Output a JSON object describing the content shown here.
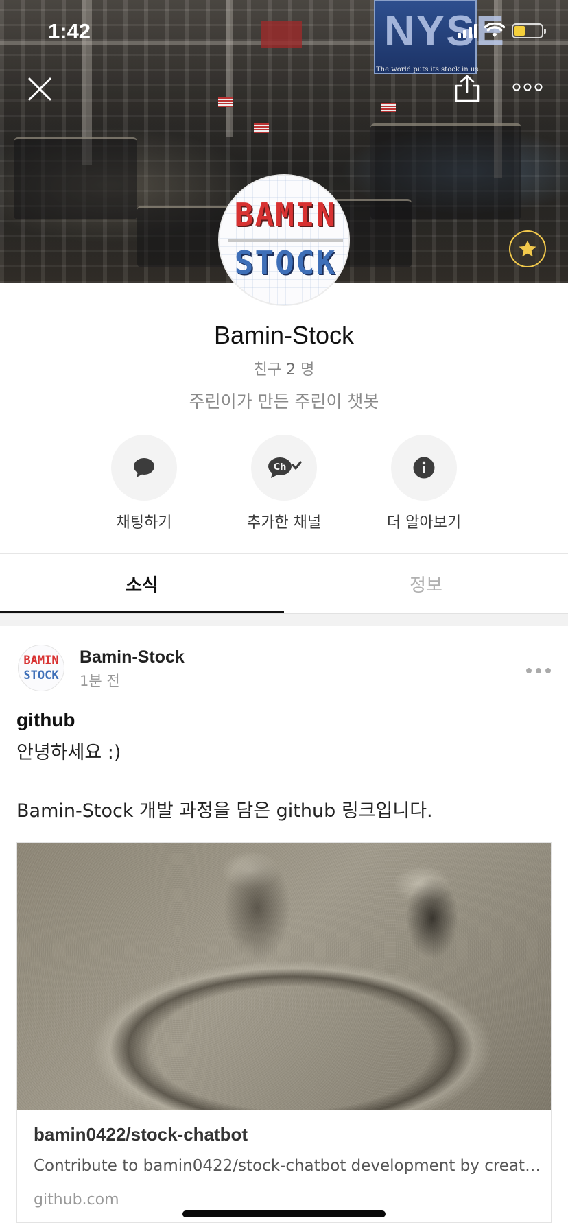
{
  "status_bar": {
    "time": "1:42",
    "battery_level": 0.4
  },
  "cover": {
    "image": "nyse-trading-floor-photo",
    "sign_text": "NYSE",
    "sign_caption": "The world puts its stock in us"
  },
  "header": {
    "close_icon": "close-icon",
    "share_icon": "share-icon",
    "more_icon": "more-icon"
  },
  "profile": {
    "logo_top": "BAMIN",
    "logo_bottom": "STOCK",
    "name": "Bamin-Stock",
    "friends_label": "친구",
    "friends_count": "2",
    "friends_unit": "명",
    "description": "주린이가 만든 주린이 챗봇"
  },
  "actions": [
    {
      "label": "채팅하기",
      "icon": "chat-bubble-icon"
    },
    {
      "label": "추가한 채널",
      "icon": "channel-added-icon"
    },
    {
      "label": "더 알아보기",
      "icon": "info-icon"
    }
  ],
  "tabs": [
    {
      "label": "소식",
      "active": true
    },
    {
      "label": "정보",
      "active": false
    }
  ],
  "post": {
    "author": "Bamin-Stock",
    "time": "1분 전",
    "title": "github",
    "body_line1": "안녕하세요 :)",
    "body_line2": "Bamin-Stock 개발 과정을 담은 github 링크입니다.",
    "link": {
      "image": "sand-smiley-face-photo",
      "title": "bamin0422/stock-chatbot",
      "description": "Contribute to bamin0422/stock-chatbot development by creati...",
      "domain": "github.com"
    }
  },
  "colors": {
    "accent_yellow": "#f2c94c",
    "logo_red": "#d83232",
    "logo_blue": "#3e6fb8",
    "tab_active": "#111111",
    "tab_inactive": "#b0b0b0"
  }
}
